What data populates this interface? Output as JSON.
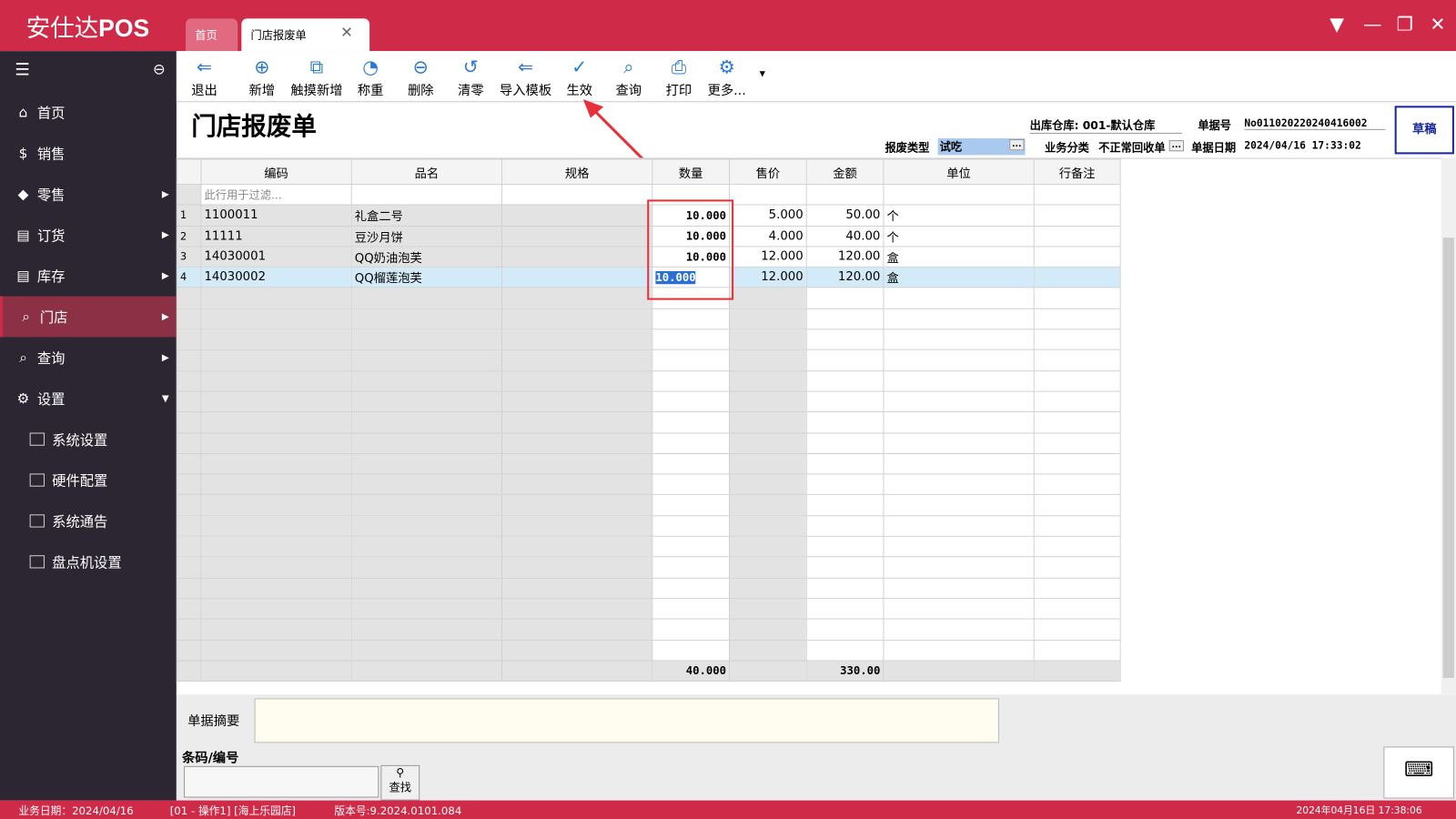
{
  "app": {
    "logo_cn": "安仕达",
    "logo_en": "POS"
  },
  "tabs": [
    {
      "label": "首页"
    },
    {
      "label": "门店报废单"
    }
  ],
  "sidebar": {
    "items": [
      {
        "label": "首页",
        "icon": "home"
      },
      {
        "label": "销售",
        "icon": "dollar"
      },
      {
        "label": "零售",
        "icon": "tag"
      },
      {
        "label": "订货",
        "icon": "box"
      },
      {
        "label": "库存",
        "icon": "box"
      },
      {
        "label": "门店",
        "icon": "search"
      },
      {
        "label": "查询",
        "icon": "search"
      },
      {
        "label": "设置",
        "icon": "gear"
      }
    ],
    "sub": [
      {
        "label": "系统设置"
      },
      {
        "label": "硬件配置"
      },
      {
        "label": "系统通告"
      },
      {
        "label": "盘点机设置"
      }
    ]
  },
  "toolbar": [
    {
      "label": "退出",
      "icon": "⇐"
    },
    {
      "label": "新增",
      "icon": "⊕"
    },
    {
      "label": "触摸新增",
      "icon": "⧉"
    },
    {
      "label": "称重",
      "icon": "◔"
    },
    {
      "label": "删除",
      "icon": "⊖"
    },
    {
      "label": "清零",
      "icon": "↺"
    },
    {
      "label": "导入模板",
      "icon": "⇐"
    },
    {
      "label": "生效",
      "icon": "✓"
    },
    {
      "label": "查询",
      "icon": "⌕"
    },
    {
      "label": "打印",
      "icon": "⎙"
    },
    {
      "label": "更多...",
      "icon": "⚙"
    }
  ],
  "page": {
    "title": "门店报废单",
    "draft": "草稿",
    "warehouse_label": "出库仓库:",
    "warehouse": "001-默认仓库",
    "docno_label": "单据号",
    "docno": "No011020220240416002",
    "type_label": "报废类型",
    "type": "试吃",
    "biz_label": "业务分类",
    "biz": "不正常回收单",
    "date_label": "单据日期",
    "date": "2024/04/16 17:33:02"
  },
  "table": {
    "headers": [
      "编码",
      "品名",
      "规格",
      "数量",
      "售价",
      "金额",
      "单位",
      "行备注"
    ],
    "filter_placeholder": "此行用于过滤...",
    "rows": [
      [
        "1",
        "1100011",
        "礼盒二号",
        "",
        "10.000",
        "5.000",
        "50.00",
        "个",
        ""
      ],
      [
        "2",
        "11111",
        "豆沙月饼",
        "",
        "10.000",
        "4.000",
        "40.00",
        "个",
        ""
      ],
      [
        "3",
        "14030001",
        "QQ奶油泡芙",
        "",
        "10.000",
        "12.000",
        "120.00",
        "盒",
        ""
      ],
      [
        "4",
        "14030002",
        "QQ榴莲泡芙",
        "",
        "10.000",
        "12.000",
        "120.00",
        "盒",
        ""
      ]
    ],
    "total_qty": "40.000",
    "total_amount": "330.00"
  },
  "bottom": {
    "memo_label": "单据摘要",
    "barcode_label": "条码/编号",
    "find_label": "查找"
  },
  "status": {
    "bizdate": "业务日期：2024/04/16",
    "operator": "[01 - 操作1]  [海上乐园店]",
    "version": "版本号:9.2024.0101.084",
    "clock": "2024年04月16日 17:38:06"
  }
}
